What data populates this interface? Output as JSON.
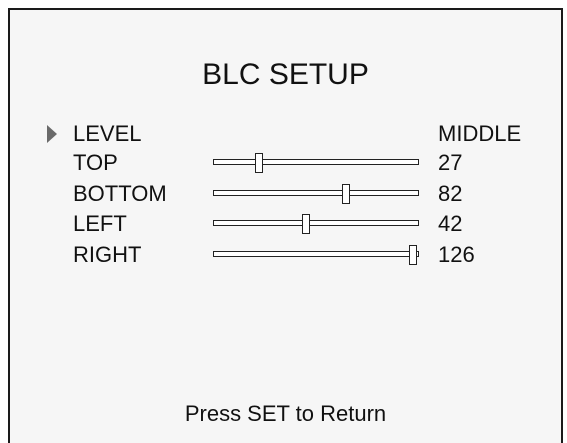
{
  "screen": {
    "title": "BLC SETUP",
    "footer": "Press SET to Return"
  },
  "menu": {
    "selected_item": "LEVEL",
    "cursor_icon": "triangle-right-icon",
    "items": [
      {
        "key": "level",
        "label": "LEVEL",
        "value": "MIDDLE",
        "type": "option"
      },
      {
        "key": "top",
        "label": "TOP",
        "value": "27",
        "type": "slider",
        "slider_level": 0.21
      },
      {
        "key": "bottom",
        "label": "BOTTOM",
        "value": "82",
        "type": "slider",
        "slider_level": 0.65
      },
      {
        "key": "left",
        "label": "LEFT",
        "value": "42",
        "type": "slider",
        "slider_level": 0.45
      },
      {
        "key": "right",
        "label": "RIGHT",
        "value": "126",
        "type": "slider",
        "slider_level": 0.99
      }
    ]
  },
  "colors": {
    "background": "#f6f6f6",
    "text": "#111111",
    "cursor": "#6a6a6a"
  }
}
